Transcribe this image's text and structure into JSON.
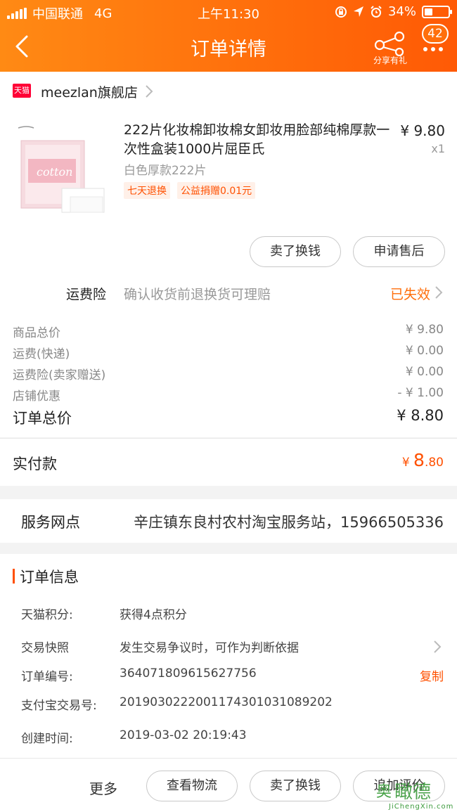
{
  "status_bar": {
    "carrier": "中国联通",
    "network": "4G",
    "time": "上午11:30",
    "battery": "34%",
    "battery_level": 0.34
  },
  "header": {
    "title": "订单详情",
    "share_label": "分享有礼",
    "badge_count": "42"
  },
  "store": {
    "badge": "天猫",
    "name": "meezlan旗舰店"
  },
  "product": {
    "name": "222片化妆棉卸妆棉女卸妆用脸部纯棉厚款一次性盒装1000片屈臣氏",
    "price": "¥ 9.80",
    "quantity": "x1",
    "sku": "白色厚款222片",
    "tags": [
      "七天退换",
      "公益捐赠0.01元"
    ],
    "thumb_text": "cotton",
    "actions": {
      "sell": "卖了换钱",
      "after_sale": "申请售后"
    }
  },
  "insurance": {
    "label": "运费险",
    "desc": "确认收货前退换货可理赔",
    "status": "已失效"
  },
  "fees": [
    {
      "label": "商品总价",
      "value": "¥ 9.80"
    },
    {
      "label": "运费(快递)",
      "value": "¥ 0.00"
    },
    {
      "label": "运费险(卖家赠送)",
      "value": "¥ 0.00"
    },
    {
      "label": "店铺优惠",
      "value": "- ¥ 1.00"
    }
  ],
  "total": {
    "label": "订单总价",
    "value": "¥ 8.80"
  },
  "paid": {
    "label": "实付款",
    "currency": "¥ ",
    "amount": "8",
    "decimals": ".80"
  },
  "service": {
    "label": "服务网点",
    "value": "辛庄镇东良村农村淘宝服务站，15966505336"
  },
  "order_info": {
    "title": "订单信息",
    "points": {
      "label": "天猫积分:",
      "value": "获得4点积分"
    },
    "snapshot": {
      "label": "交易快照",
      "value": "发生交易争议时，可作为判断依据"
    },
    "order_no": {
      "label": "订单编号:",
      "value": "364071809615627756",
      "action": "复制"
    },
    "alipay_no": {
      "label": "支付宝交易号:",
      "value": "2019030222001174301031089202"
    },
    "created": {
      "label": "创建时间:",
      "value": "2019-03-02 20:19:43"
    }
  },
  "bottom_bar": {
    "more": "更多",
    "logistics": "查看物流",
    "sell": "卖了换钱",
    "review": "追加评价"
  },
  "watermark": {
    "glyph": "奥",
    "text": "瞰德",
    "url": "JiChengXin.com"
  },
  "colors": {
    "accent": "#ff6f0c",
    "price": "#ff5000",
    "tmall": "#ff0036"
  },
  "icons": [
    "signal-icon",
    "location-icon",
    "alarm-icon",
    "lock-rotation-icon",
    "battery-icon",
    "back-icon",
    "share-icon",
    "more-icon",
    "chevron-right-icon"
  ]
}
